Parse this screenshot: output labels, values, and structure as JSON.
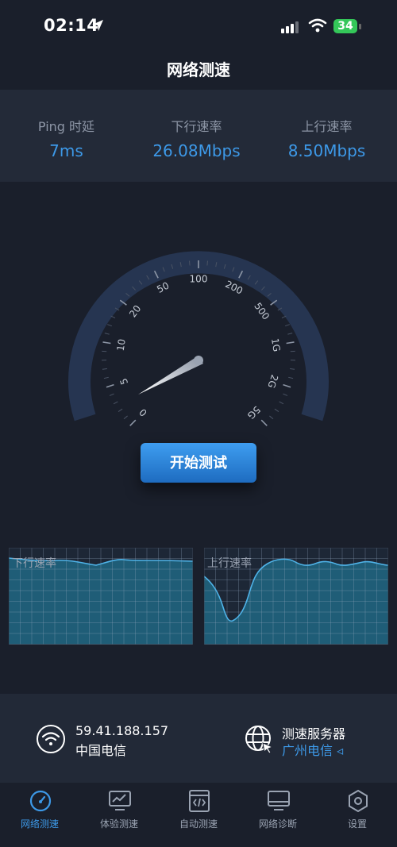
{
  "status_bar": {
    "time": "02:14",
    "battery": "34"
  },
  "title": "网络测速",
  "stats": [
    {
      "label": "Ping 时延",
      "value": "7ms"
    },
    {
      "label": "下行速率",
      "value": "26.08Mbps"
    },
    {
      "label": "上行速率",
      "value": "8.50Mbps"
    }
  ],
  "gauge": {
    "ticks": [
      "0",
      "5",
      "10",
      "20",
      "50",
      "100",
      "200",
      "500",
      "1G",
      "2G",
      "5G"
    ],
    "needle_value": "5"
  },
  "start_button": "开始测试",
  "graphs": {
    "download_label": "下行速率",
    "upload_label": "上行速率"
  },
  "connection": {
    "ip": "59.41.188.157",
    "isp": "中国电信"
  },
  "server": {
    "title": "测速服务器",
    "name": "广州电信 ◃"
  },
  "tabs": [
    {
      "label": "网络测速",
      "icon": "speedometer-icon",
      "active": true
    },
    {
      "label": "体验测速",
      "icon": "chart-monitor-icon",
      "active": false
    },
    {
      "label": "自动测速",
      "icon": "code-file-icon",
      "active": false
    },
    {
      "label": "网络诊断",
      "icon": "monitor-icon",
      "active": false
    },
    {
      "label": "设置",
      "icon": "hexagon-gear-icon",
      "active": false
    }
  ],
  "colors": {
    "accent": "#3d99e8",
    "background": "#1a1f2b",
    "panel": "#232a38",
    "graph_line": "#4fb3e8"
  }
}
